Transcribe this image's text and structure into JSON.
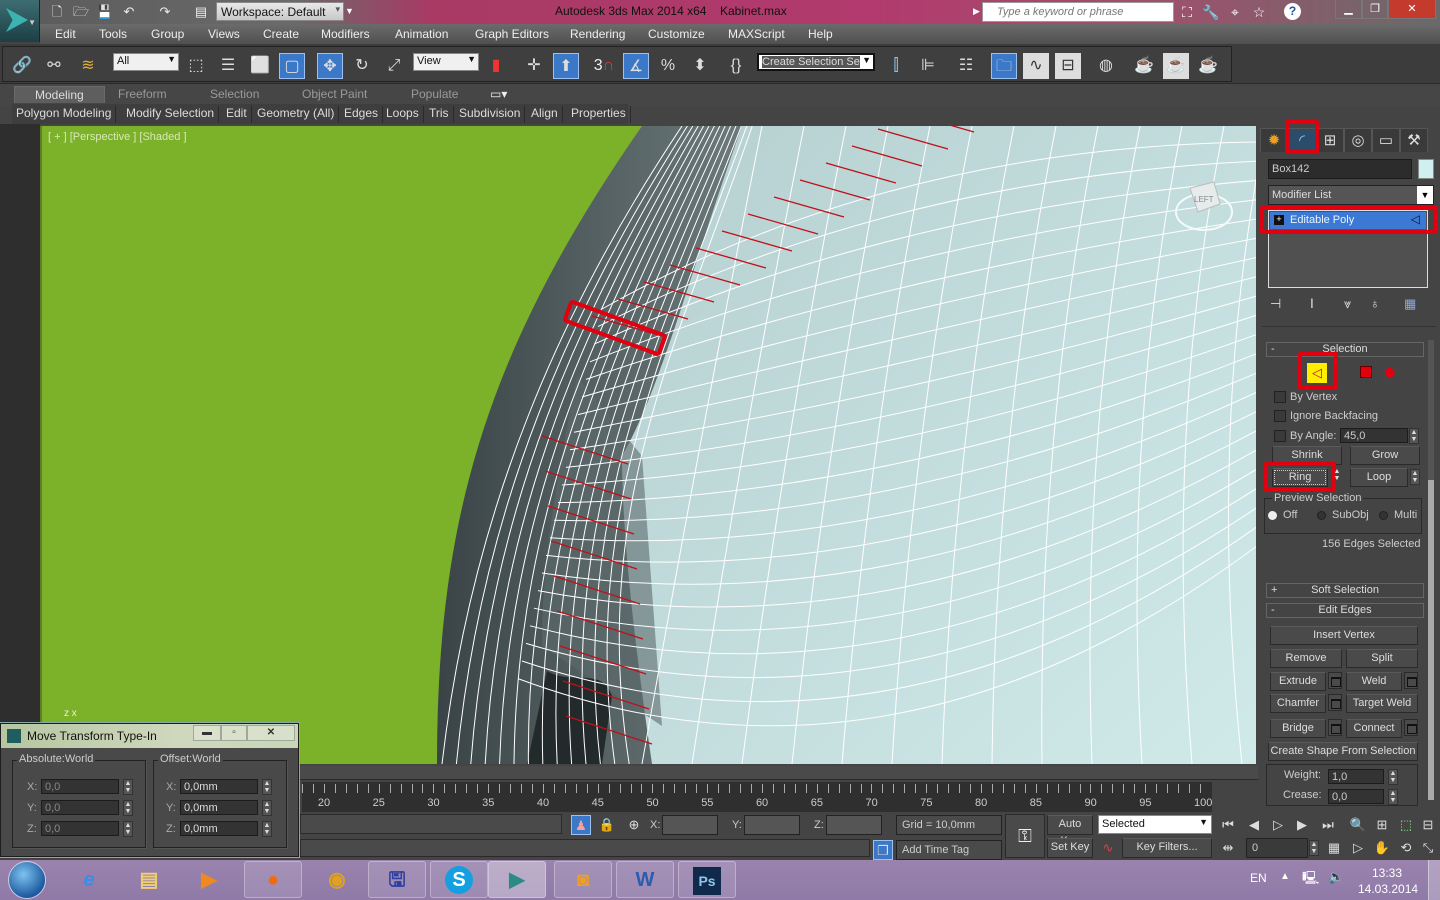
{
  "titlebar": {
    "app_title": "Autodesk 3ds Max  2014 x64",
    "file_name": "Kabinet.max",
    "workspace": "Workspace: Default",
    "search_placeholder": "Type a keyword or phrase",
    "quick_access_icons": [
      "new-file-icon",
      "open-file-icon",
      "save-icon",
      "undo-icon",
      "redo-icon",
      "project-folder-icon"
    ],
    "help_icons": [
      "binoculars-icon",
      "key-icon",
      "satellite-icon",
      "star-icon",
      "help-icon"
    ]
  },
  "menu": [
    "Edit",
    "Tools",
    "Group",
    "Views",
    "Create",
    "Modifiers",
    "Animation",
    "Graph Editors",
    "Rendering",
    "Customize",
    "MAXScript",
    "Help"
  ],
  "toolbar": {
    "selection_filter": "All",
    "ref_coord": "View",
    "snap_3": "3",
    "named_selection_placeholder": "Create Selection Se"
  },
  "ribbon": {
    "tabs": [
      "Modeling",
      "Freeform",
      "Selection",
      "Object Paint",
      "Populate"
    ],
    "active_tab": "Modeling",
    "panels": [
      "Polygon Modeling",
      "Modify Selection",
      "Edit",
      "Geometry (All)",
      "Edges",
      "Loops",
      "Tris",
      "Subdivision",
      "Align",
      "Properties"
    ]
  },
  "viewport": {
    "label": "[ + ] [Perspective ] [Shaded ]",
    "viewcube_face": "LEFT",
    "axis_label": "z x",
    "background": "#7cb12a",
    "selection_color": "#c0101a"
  },
  "command_panel": {
    "object_name": "Box142",
    "object_color": "#d0f0f0",
    "modifier_list": "Modifier List",
    "stack_item": "Editable Poly",
    "highlight_color": "#e00010",
    "selection": {
      "title": "Selection",
      "by_vertex": "By Vertex",
      "ignore_backfacing": "Ignore Backfacing",
      "by_angle": "By Angle:",
      "angle_value": "45,0",
      "shrink": "Shrink",
      "grow": "Grow",
      "ring": "Ring",
      "loop": "Loop",
      "preview_title": "Preview Selection",
      "preview_options": [
        "Off",
        "SubObj",
        "Multi"
      ],
      "preview_selected": "Off",
      "status": "156 Edges Selected"
    },
    "soft_selection": "Soft Selection",
    "edit_edges": {
      "title": "Edit Edges",
      "insert_vertex": "Insert Vertex",
      "remove": "Remove",
      "split": "Split",
      "extrude": "Extrude",
      "weld": "Weld",
      "chamfer": "Chamfer",
      "target_weld": "Target Weld",
      "bridge": "Bridge",
      "connect": "Connect",
      "create_shape": "Create Shape From Selection",
      "weight_label": "Weight:",
      "weight": "1,0",
      "crease_label": "Crease:",
      "crease": "0,0"
    }
  },
  "timeline": {
    "labels": [
      "20",
      "25",
      "30",
      "35",
      "40",
      "45",
      "50",
      "55",
      "60",
      "65",
      "70",
      "75",
      "80",
      "85",
      "90",
      "95",
      "100"
    ]
  },
  "status": {
    "x_label": "X:",
    "y_label": "Y:",
    "z_label": "Z:",
    "grid": "Grid = 10,0mm",
    "add_time_tag": "Add Time Tag",
    "auto_key": "Auto Key",
    "set_key": "Set Key",
    "key_mode": "Selected",
    "key_filters": "Key Filters...",
    "frame": "0"
  },
  "dialog": {
    "title": "Move Transform Type-In",
    "absolute_title": "Absolute:World",
    "offset_title": "Offset:World",
    "absolute": {
      "x": "0,0",
      "y": "0,0",
      "z": "0,0"
    },
    "offset": {
      "x": "0,0mm",
      "y": "0,0mm",
      "z": "0,0mm"
    },
    "labels": {
      "x": "X:",
      "y": "Y:",
      "z": "Z:"
    }
  },
  "taskbar": {
    "apps": [
      "internet-explorer",
      "file-explorer",
      "media-player",
      "firefox",
      "chrome",
      "save-app",
      "skype",
      "3ds-max",
      "photo-viewer",
      "word",
      "photoshop"
    ],
    "language": "EN",
    "time": "13:33",
    "date": "14.03.2014"
  }
}
